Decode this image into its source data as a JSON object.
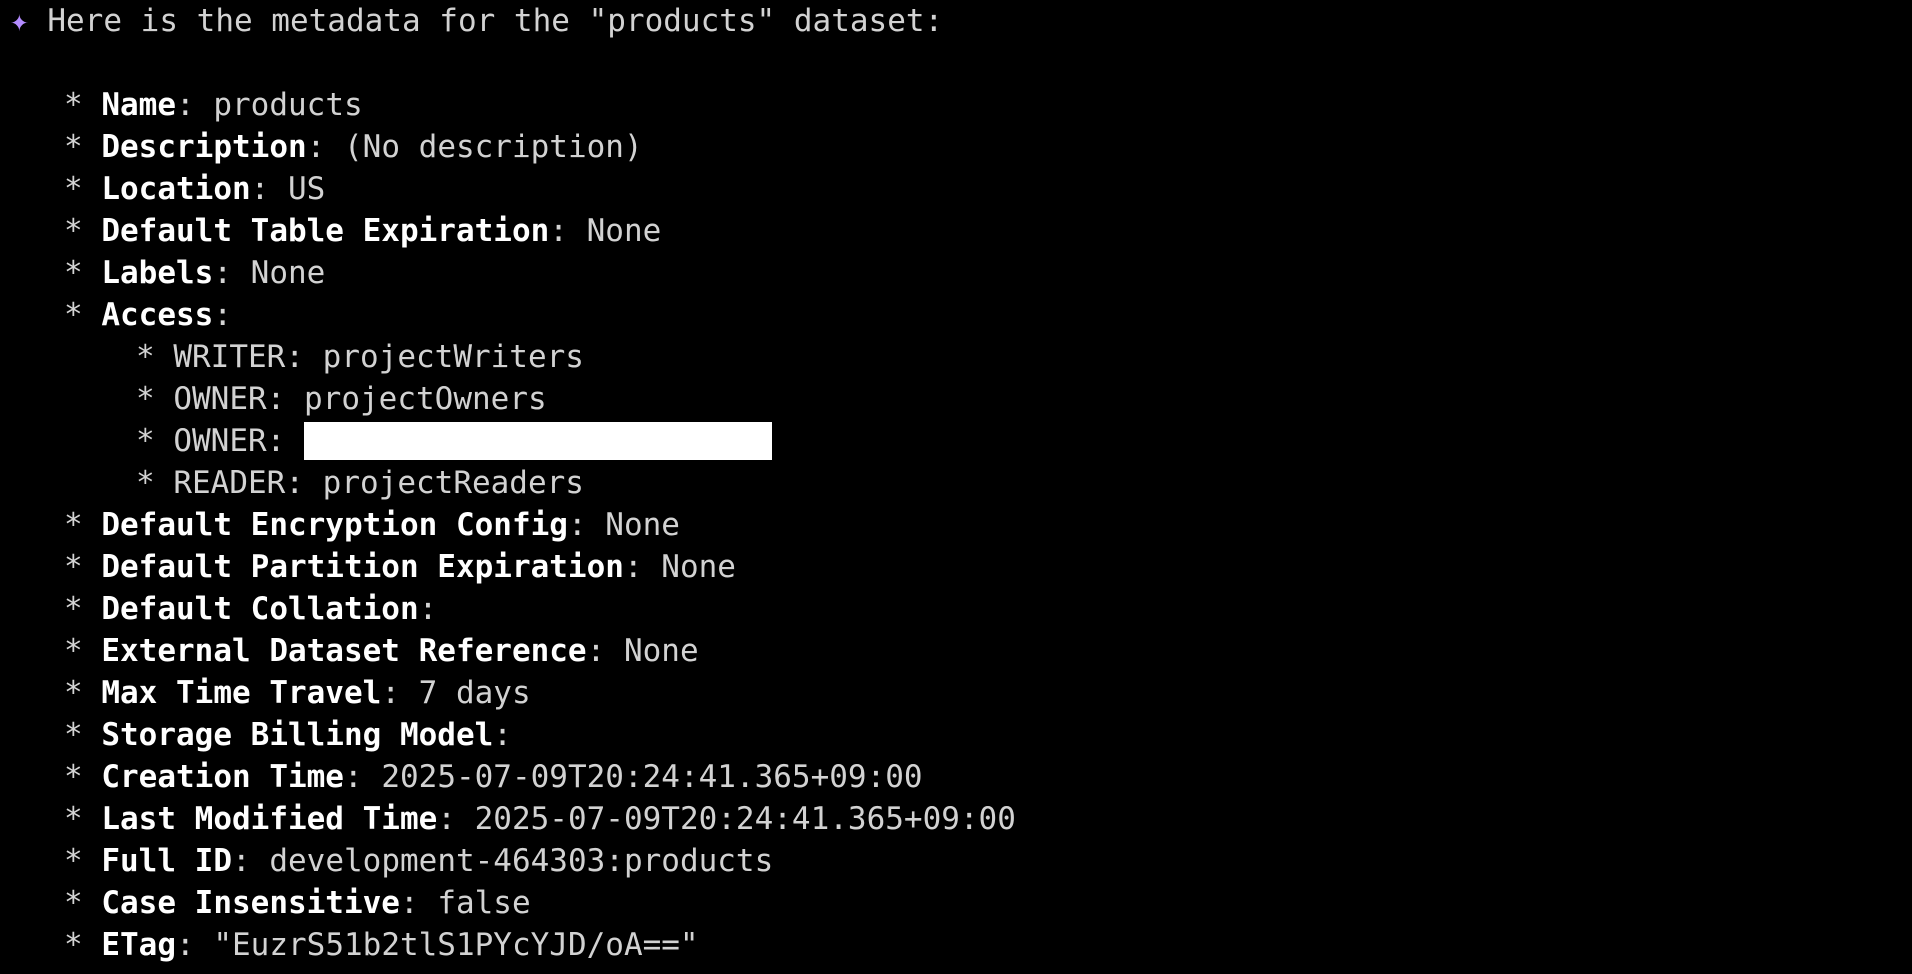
{
  "terminal": {
    "prompt_icon": "sparkle-icon",
    "accent_color": "#b48cff",
    "intro": "Here is the metadata for the \"products\" dataset:",
    "bullet": "*",
    "separator": ":",
    "fields": [
      {
        "key": "Name",
        "value": "products"
      },
      {
        "key": "Description",
        "value": "(No description)"
      },
      {
        "key": "Location",
        "value": "US"
      },
      {
        "key": "Default Table Expiration",
        "value": "None"
      },
      {
        "key": "Labels",
        "value": "None"
      },
      {
        "key": "Access",
        "value": ""
      }
    ],
    "access": [
      {
        "role": "WRITER",
        "value": "projectWriters"
      },
      {
        "role": "OWNER",
        "value": "projectOwners"
      },
      {
        "role": "OWNER",
        "value": ""
      },
      {
        "role": "READER",
        "value": "projectReaders"
      }
    ],
    "fields_after": [
      {
        "key": "Default Encryption Config",
        "value": "None"
      },
      {
        "key": "Default Partition Expiration",
        "value": "None"
      },
      {
        "key": "Default Collation",
        "value": ""
      },
      {
        "key": "External Dataset Reference",
        "value": "None"
      },
      {
        "key": "Max Time Travel",
        "value": "7 days"
      },
      {
        "key": "Storage Billing Model",
        "value": ""
      },
      {
        "key": "Creation Time",
        "value": "2025-07-09T20:24:41.365+09:00"
      },
      {
        "key": "Last Modified Time",
        "value": "2025-07-09T20:24:41.365+09:00"
      },
      {
        "key": "Full ID",
        "value": "development-464303:products"
      },
      {
        "key": "Case Insensitive",
        "value": "false"
      },
      {
        "key": "ETag",
        "value": "\"EuzrS51b2tlS1PYcYJD/oA==\""
      }
    ]
  }
}
